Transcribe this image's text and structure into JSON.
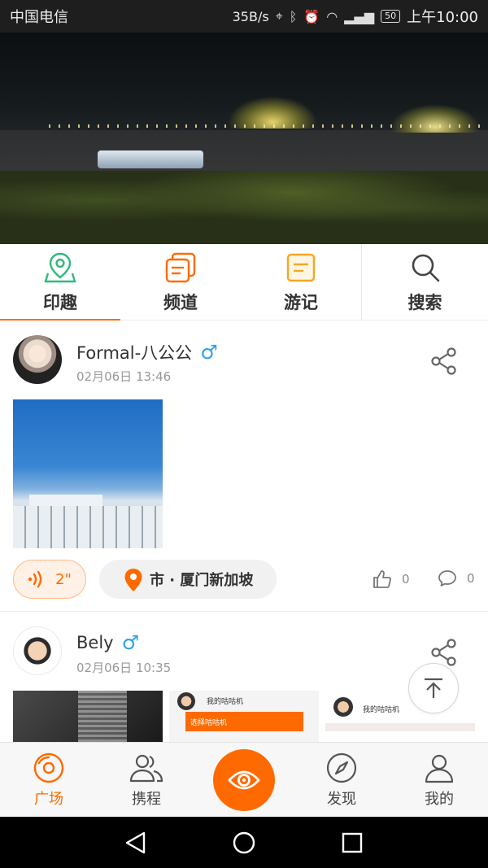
{
  "status_bar": {
    "carrier": "中国电信",
    "speed": "35B/s",
    "battery": "50",
    "time": "上午10:00"
  },
  "banner": {
    "page_count": 3,
    "active_index": 0
  },
  "category_tabs": [
    {
      "label": "印趣",
      "icon": "map-pin-icon",
      "active": true
    },
    {
      "label": "频道",
      "icon": "channel-cards-icon",
      "active": false
    },
    {
      "label": "游记",
      "icon": "notes-icon",
      "active": false
    },
    {
      "label": "搜索",
      "icon": "search-icon",
      "active": false
    }
  ],
  "posts": [
    {
      "username": "Formal-八公公",
      "gender_symbol": "♂",
      "date": "02月06日 13:46",
      "voice_duration": "2\"",
      "location": "市 · 厦门新加坡",
      "likes": "0",
      "comments": "0"
    },
    {
      "username": "Bely",
      "gender_symbol": "♂",
      "date": "02月06日 10:35",
      "thumb2_title": "我的咕咕机",
      "thumb2_bar": "选择咕咕机",
      "thumb3_title": "我的咕咕机"
    }
  ],
  "bottom_nav": [
    {
      "label": "广场",
      "icon": "plaza-icon",
      "active": true
    },
    {
      "label": "携程",
      "icon": "people-icon",
      "active": false
    },
    {
      "label": "",
      "icon": "eye-icon",
      "active": false
    },
    {
      "label": "发现",
      "icon": "compass-icon",
      "active": false
    },
    {
      "label": "我的",
      "icon": "user-icon",
      "active": false
    }
  ],
  "colors": {
    "accent": "#ff6a00",
    "tab_green": "#2fb97a",
    "male_blue": "#2f9ee8"
  }
}
